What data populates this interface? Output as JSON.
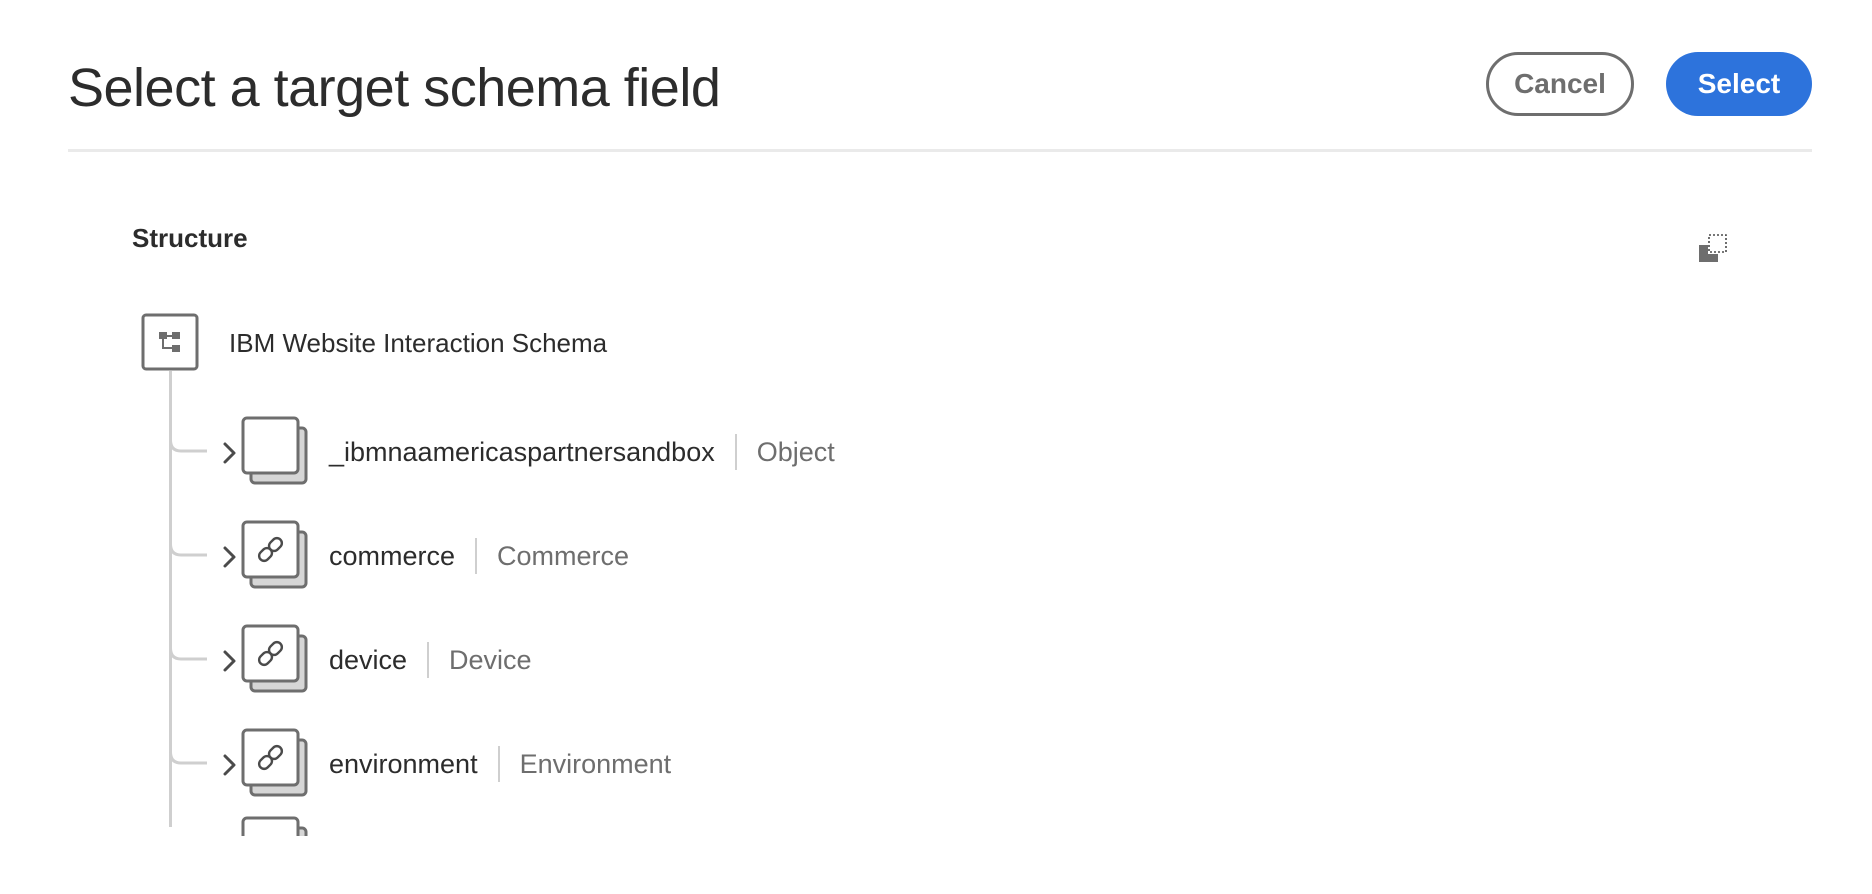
{
  "dialog": {
    "title": "Select a target schema field",
    "cancel_label": "Cancel",
    "select_label": "Select"
  },
  "colors": {
    "primary_button": "#2d73dc",
    "secondary_border": "#6e6e6e",
    "divider": "#eaeaea",
    "tree_line": "#cfcfcf"
  },
  "structure": {
    "heading": "Structure",
    "fit_icon": "fit-to-view-icon",
    "root": {
      "label": "IBM Website Interaction Schema",
      "icon": "schema-tree-icon"
    },
    "fields": [
      {
        "name": "_ibmnaamericaspartnersandbox",
        "type": "Object",
        "icon": "object-icon",
        "expandable": true
      },
      {
        "name": "commerce",
        "type": "Commerce",
        "icon": "link-icon",
        "expandable": true
      },
      {
        "name": "device",
        "type": "Device",
        "icon": "link-icon",
        "expandable": true
      },
      {
        "name": "environment",
        "type": "Environment",
        "icon": "link-icon",
        "expandable": true
      }
    ]
  }
}
